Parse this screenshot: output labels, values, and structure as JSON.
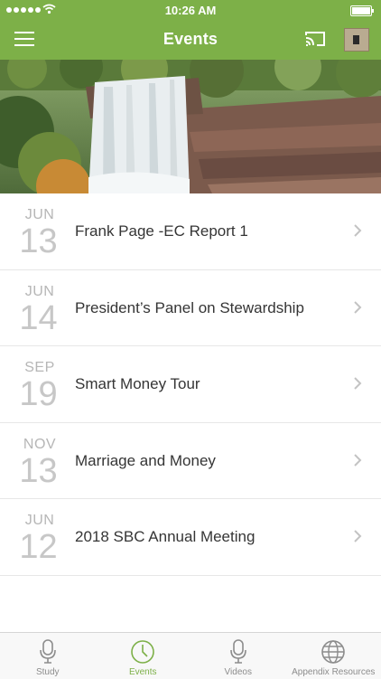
{
  "status_bar": {
    "time": "10:26 AM"
  },
  "header": {
    "title": "Events",
    "icons": {
      "menu": "hamburger-menu-icon",
      "cast": "cast-icon",
      "avatar": "profile-thumbnail"
    }
  },
  "banner": {
    "image": "waterfall landscape"
  },
  "events": [
    {
      "month": "JUN",
      "day": "13",
      "title": "Frank Page -EC Report 1"
    },
    {
      "month": "JUN",
      "day": "14",
      "title": "President’s Panel on Stewardship"
    },
    {
      "month": "SEP",
      "day": "19",
      "title": "Smart Money Tour"
    },
    {
      "month": "NOV",
      "day": "13",
      "title": "Marriage and  Money"
    },
    {
      "month": "JUN",
      "day": "12",
      "title": "2018 SBC Annual Meeting"
    }
  ],
  "tabs": [
    {
      "label": "Study",
      "icon": "microphone-icon",
      "active": false
    },
    {
      "label": "Events",
      "icon": "clock-icon",
      "active": true
    },
    {
      "label": "Videos",
      "icon": "microphone-icon",
      "active": false
    },
    {
      "label": "Appendix Resources",
      "icon": "globe-icon",
      "active": false
    }
  ],
  "colors": {
    "accent": "#7db048",
    "text": "#353535",
    "muted": "#c7c7c7"
  }
}
